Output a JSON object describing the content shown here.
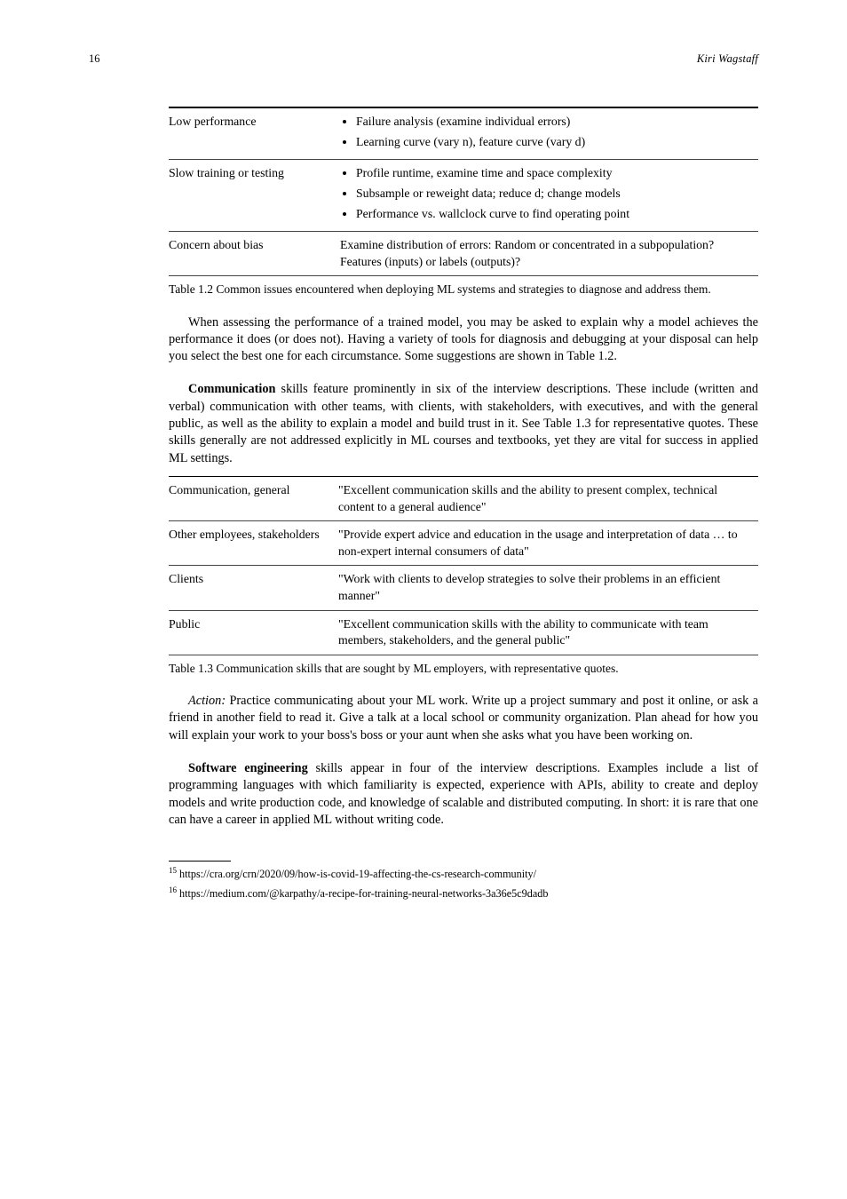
{
  "header": {
    "page_number": "16",
    "running_title": "Kiri Wagstaff"
  },
  "table1": {
    "rows": [
      {
        "label": "Low performance",
        "items": [
          "Failure analysis (examine individual errors)",
          "Learning curve (vary n), feature curve (vary d)"
        ]
      },
      {
        "label": "Slow training or testing",
        "items": [
          "Profile runtime, examine time and space complexity",
          "Subsample or reweight data; reduce d; change models",
          "Performance vs. wallclock curve to find operating point"
        ]
      },
      {
        "label": "Concern about bias",
        "items": [
          "Examine distribution of errors: Random or concentrated in a subpopulation? Features (inputs) or labels (outputs)?"
        ]
      }
    ],
    "caption": "Table 1.2 Common issues encountered when deploying ML systems and strategies to diagnose and address them."
  },
  "para1": "When assessing the performance of a trained model, you may be asked to explain why a model achieves the performance it does (or does not). Having a variety of tools for diagnosis and debugging at your disposal can help you select the best one for each circumstance. Some suggestions are shown in Table 1.2.",
  "para2_label": "Communication",
  "para2": " skills feature prominently in six of the interview descriptions. These include (written and verbal) communication with other teams, with clients, with stakeholders, with executives, and with the general public, as well as the ability to explain a model and build trust in it. See Table 1.3 for representative quotes. These skills generally are not addressed explicitly in ML courses and textbooks, yet they are vital for success in applied ML settings.",
  "table2": {
    "rows": [
      {
        "label": "Communication, general",
        "text": "\"Excellent communication skills and the ability to present complex, technical content to a general audience\""
      },
      {
        "label": "Other employees, stakeholders",
        "text": "\"Provide expert advice and education in the usage and interpretation of data … to non-expert internal consumers of data\""
      },
      {
        "label": "Clients",
        "text": "\"Work with clients to develop strategies to solve their problems in an efficient manner\""
      },
      {
        "label": "Public",
        "text": "\"Excellent communication skills with the ability to communicate with team members, stakeholders, and the general public\""
      }
    ],
    "caption": "Table 1.3 Communication skills that are sought by ML employers, with representative quotes."
  },
  "para3_prefix": "Action: ",
  "para3": "Practice communicating about your ML work. Write up a project summary and post it online, or ask a friend in another field to read it. Give a talk at a local school or community organization. Plan ahead for how you will explain your work to your boss's boss or your aunt when she asks what you have been working on.",
  "para4_label": "Software engineering",
  "para4": " skills appear in four of the interview descriptions. Examples include a list of programming languages with which familiarity is expected, experience with APIs, ability to create and deploy models and write production code, and knowledge of scalable and distributed computing. In short: it is rare that one can have a career in applied ML without writing code.",
  "footnotes": [
    {
      "num": "15",
      "text": " https://cra.org/crn/2020/09/how-is-covid-19-affecting-the-cs-research-community/"
    },
    {
      "num": "16",
      "text": " https://medium.com/@karpathy/a-recipe-for-training-neural-networks-3a36e5c9dadb"
    }
  ]
}
